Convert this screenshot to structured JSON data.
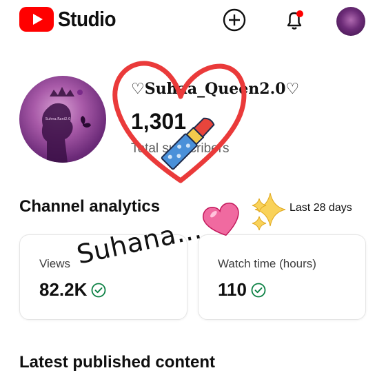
{
  "header": {
    "app_name": "Studio",
    "icons": [
      "youtube-logo-icon",
      "plus-circle-icon",
      "bell-icon",
      "avatar"
    ],
    "colors": {
      "brand": "#ff0000",
      "notification_dot": "#ff0000"
    }
  },
  "channel": {
    "name": "♡Suhaa_Queen2.0♡",
    "subscriber_count": "1,301",
    "subscriber_label": "Total subscribers"
  },
  "analytics": {
    "title": "Channel analytics",
    "period": "Last 28 days",
    "cards": [
      {
        "label": "Views",
        "value": "82.2K",
        "status_icon": "check-circle-icon"
      },
      {
        "label": "Watch time (hours)",
        "value": "110",
        "status_icon": "check-circle-icon"
      }
    ],
    "colors": {
      "check": "#0b8043"
    }
  },
  "latest": {
    "title": "Latest published content"
  },
  "stickers": {
    "handwritten": "Suhana...",
    "icons": [
      "heart-outline-sticker",
      "lipstick-sticker",
      "pink-heart-sticker",
      "sparkles-sticker"
    ],
    "colors": {
      "heart": "#ea3a3a",
      "lipstick_cap": "#4a90d9",
      "lipstick_tip": "#e8453c"
    }
  }
}
